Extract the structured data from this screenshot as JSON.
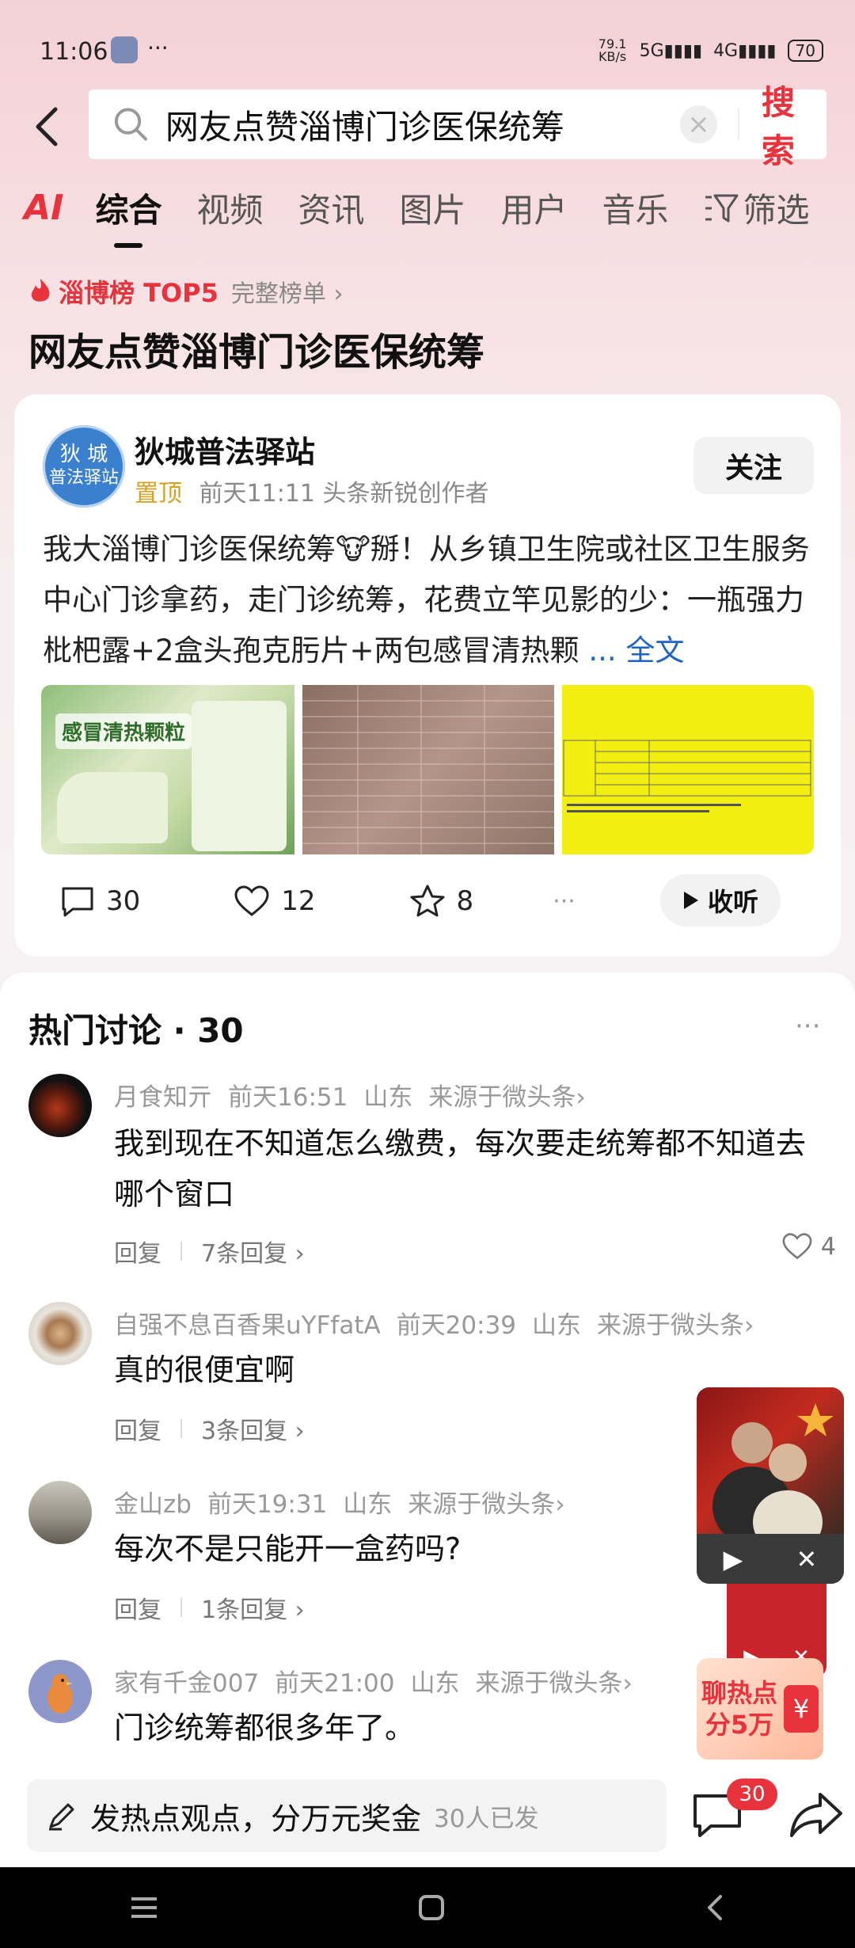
{
  "status_bar": {
    "time": "11:06",
    "extra": "···",
    "net_speed": "79.1 KB/s",
    "signal1": "5G",
    "signal2": "4G",
    "battery": "70"
  },
  "search": {
    "query": "网友点赞淄博门诊医保统筹",
    "clear_icon": "clear-icon",
    "button_label": "搜索"
  },
  "tabs": {
    "ai_label": "AI",
    "items": [
      "综合",
      "视频",
      "资讯",
      "图片",
      "用户",
      "音乐"
    ],
    "active": "综合",
    "filter_label": "筛选"
  },
  "rank": {
    "name": "淄博榜 TOP5",
    "full_list": "完整榜单 ›"
  },
  "topic_title": "网友点赞淄博门诊医保统筹",
  "post": {
    "author": "狄城普法驿站",
    "avatar_text_top": "狄 城",
    "avatar_text_bottom": "普法驿站",
    "pin_label": "置顶",
    "meta": "前天11:11 头条新锐创作者",
    "follow_label": "关注",
    "text": "我大淄博门诊医保统筹🐮掰！从乡镇卫生院或社区卫生服务中心门诊拿药，走门诊统筹，花费立竿见影的少：一瓶强力枇杷露+2盒头孢克肟片+两包感冒清热颗",
    "more_label": "... 全文",
    "image1_text": "感冒清热颗粒",
    "comments": "30",
    "likes": "12",
    "favorites": "8",
    "more_dots": "···",
    "listen_label": "收听"
  },
  "discussion": {
    "title": "热门讨论 · 30",
    "more_dots": "···",
    "comments": [
      {
        "user": "月食知亓",
        "time": "前天16:51",
        "location": "山东",
        "source": "来源于微头条›",
        "text": "我到现在不知道怎么缴费，每次要走统筹都不知道去哪个窗口",
        "reply_label": "回复",
        "replies": "7条回复 ›",
        "likes": "4"
      },
      {
        "user": "自强不息百香果uYFfatA",
        "time": "前天20:39",
        "location": "山东",
        "source": "来源于微头条›",
        "text": "真的很便宜啊",
        "reply_label": "回复",
        "replies": "3条回复 ›"
      },
      {
        "user": "金山zb",
        "time": "前天19:31",
        "location": "山东",
        "source": "来源于微头条›",
        "text": "每次不是只能开一盒药吗?",
        "reply_label": "回复",
        "replies": "1条回复 ›"
      },
      {
        "user": "家有千金007",
        "time": "前天21:00",
        "location": "山东",
        "source": "来源于微头条›",
        "text": "门诊统筹都很多年了。"
      }
    ]
  },
  "floating": {
    "prize_text_line1": "聊热点",
    "prize_text_line2": "分5万",
    "prize_yen": "¥"
  },
  "bottom": {
    "compose_placeholder": "发热点观点，分万元奖金",
    "participants": "30人已发",
    "comment_badge": "30"
  },
  "colors": {
    "accent": "#e8323c",
    "link": "#1e63c7",
    "pin": "#d6a021"
  }
}
